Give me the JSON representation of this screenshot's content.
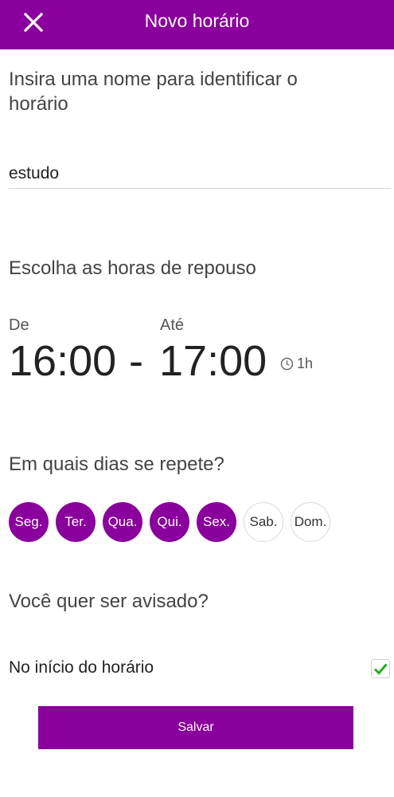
{
  "colors": {
    "brand": "#8a009c",
    "check": "#22b022"
  },
  "header": {
    "title": "Novo horário",
    "close_icon": "close-icon"
  },
  "name_section": {
    "prompt": "Insira uma nome para identificar o horário",
    "value": "estudo"
  },
  "time_section": {
    "title": "Escolha as horas de repouso",
    "from_label": "De",
    "to_label": "Até",
    "from_time": "16:00",
    "separator": "-",
    "to_time": "17:00",
    "duration": "1h",
    "duration_icon": "clock-icon"
  },
  "days_section": {
    "title": "Em quais dias se repete?",
    "days": [
      {
        "label": "Seg.",
        "selected": true
      },
      {
        "label": "Ter.",
        "selected": true
      },
      {
        "label": "Qua.",
        "selected": true
      },
      {
        "label": "Qui.",
        "selected": true
      },
      {
        "label": "Sex.",
        "selected": true
      },
      {
        "label": "Sab.",
        "selected": false
      },
      {
        "label": "Dom.",
        "selected": false
      }
    ]
  },
  "notify_section": {
    "title": "Você quer ser avisado?",
    "option_label": "No início do horário",
    "option_checked": true
  },
  "save_label": "Salvar"
}
